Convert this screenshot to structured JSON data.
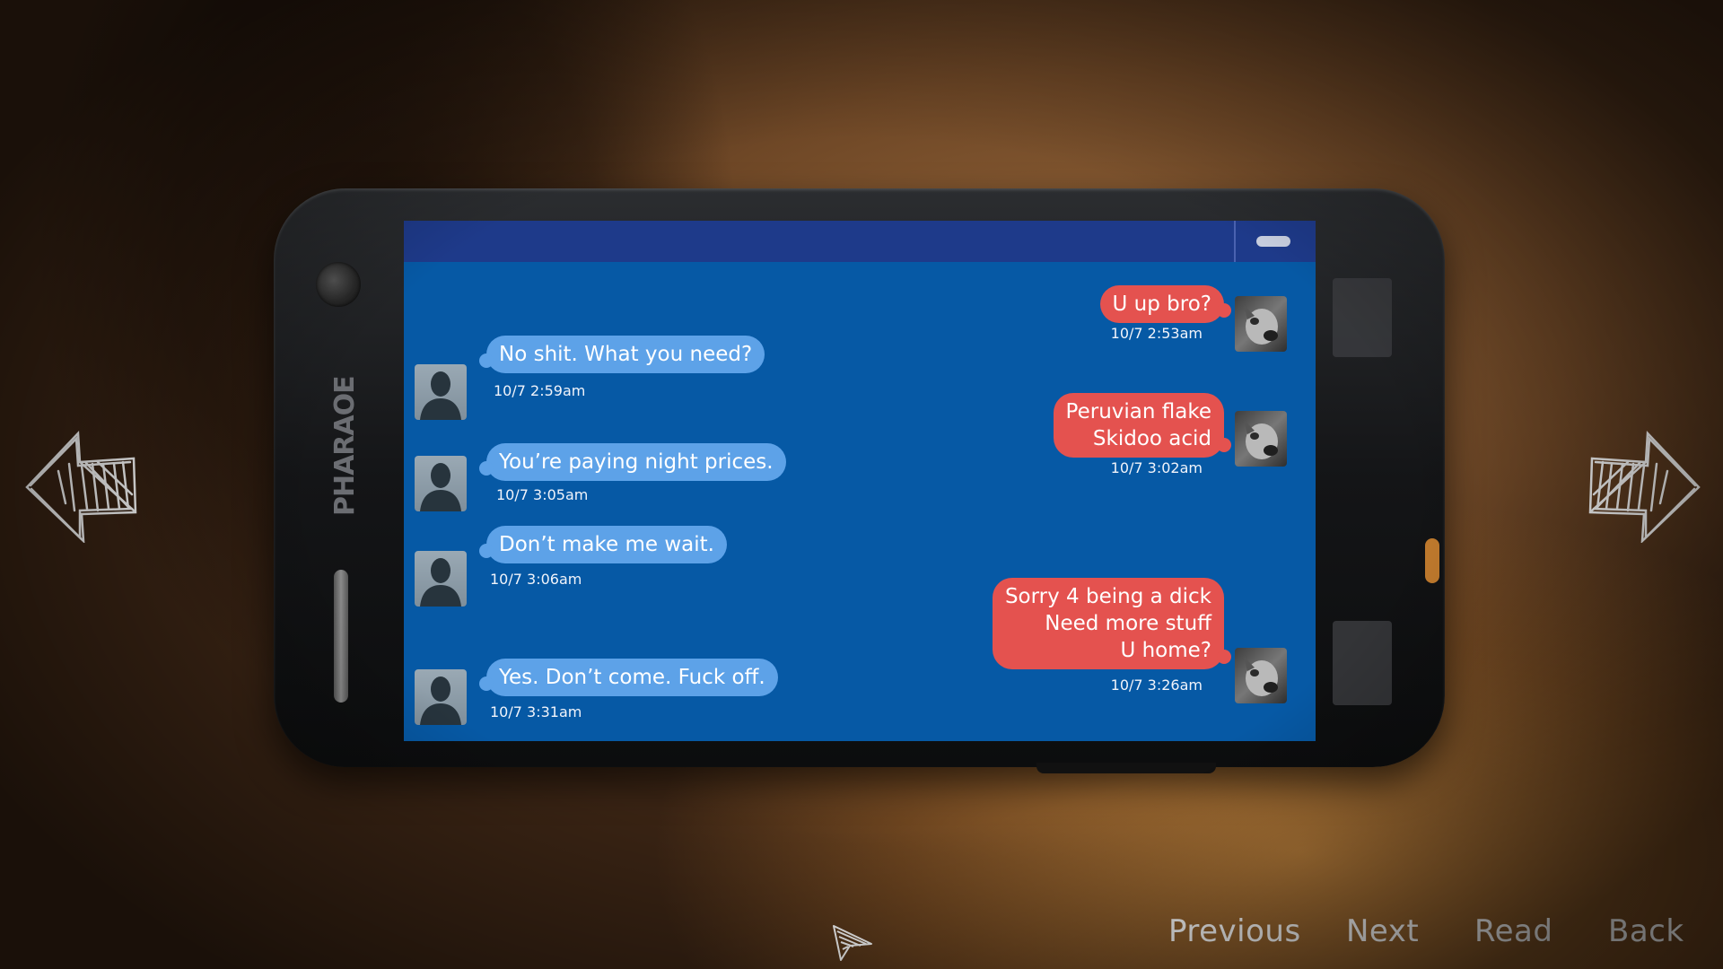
{
  "phone": {
    "brand": "PHARAOE"
  },
  "messages": [
    {
      "direction": "out",
      "text": "U up bro?",
      "timestamp": "10/7 2:53am"
    },
    {
      "direction": "in",
      "text": "No shit. What you need?",
      "timestamp": "10/7 2:59am"
    },
    {
      "direction": "out",
      "text": "Peruvian flake\nSkidoo acid",
      "timestamp": "10/7 3:02am"
    },
    {
      "direction": "in",
      "text": "You’re paying night prices.",
      "timestamp": "10/7 3:05am"
    },
    {
      "direction": "in",
      "text": "Don’t make me wait.",
      "timestamp": "10/7 3:06am"
    },
    {
      "direction": "out",
      "text": "Sorry 4 being a dick\nNeed more stuff\nU home?",
      "timestamp": "10/7 3:26am"
    },
    {
      "direction": "in",
      "text": "Yes. Don’t come. Fuck off.",
      "timestamp": "10/7 3:31am"
    }
  ],
  "colors": {
    "screen_bg": "#0659a5",
    "top_bar": "#1e3a8a",
    "incoming_bubble": "#5da2e8",
    "outgoing_bubble": "#e4524f"
  },
  "nav": {
    "left_icon": "sketch-arrow-left-icon",
    "right_icon": "sketch-arrow-right-icon"
  },
  "menu": {
    "previous": "Previous",
    "next": "Next",
    "read": "Read",
    "back": "Back"
  }
}
